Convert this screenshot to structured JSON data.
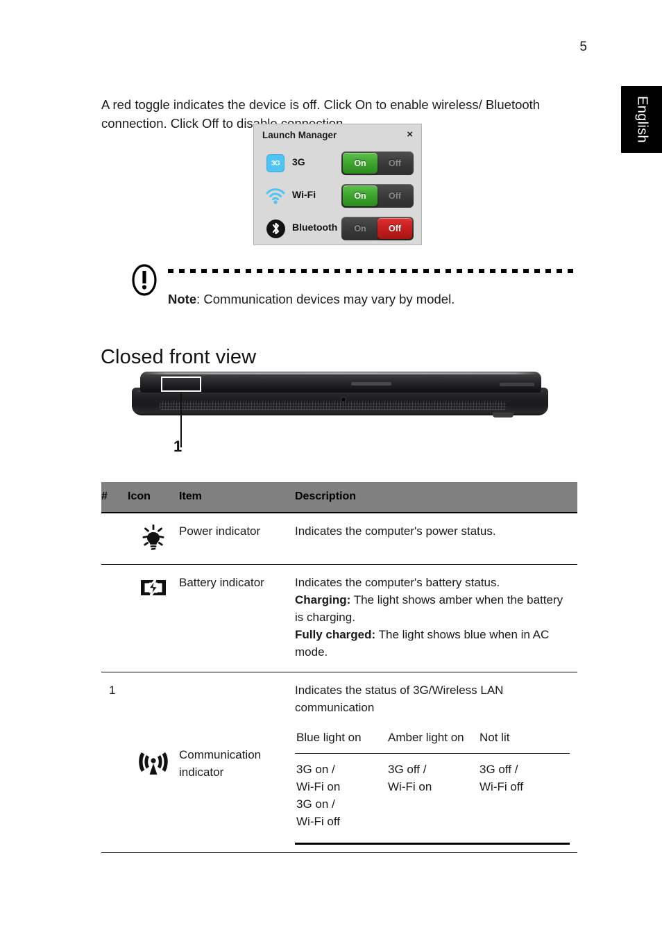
{
  "page": {
    "number": "5",
    "language_tab": "English"
  },
  "intro": {
    "paragraph": "A red toggle indicates the device is off. Click On to enable wireless/ Bluetooth connection. Click Off to disable connection."
  },
  "launch_manager": {
    "title": "Launch Manager",
    "close_label": "×",
    "rows": [
      {
        "icon": "3g-icon",
        "label": "3G",
        "on_label": "On",
        "off_label": "Off",
        "state": "on"
      },
      {
        "icon": "wifi-icon",
        "label": "Wi-Fi",
        "on_label": "On",
        "off_label": "Off",
        "state": "on"
      },
      {
        "icon": "bluetooth-icon",
        "label": "Bluetooth",
        "on_label": "On",
        "off_label": "Off",
        "state": "off"
      }
    ],
    "colors": {
      "on_green": "#3ba32c",
      "off_red": "#c41d1d",
      "window_bg": "#d9d9d9",
      "toggle_bg": "#3a3a3a"
    }
  },
  "note": {
    "icon": "exclamation-oval-icon",
    "label": "Note",
    "separator": ": ",
    "text": "Communication devices may vary by model."
  },
  "section": {
    "heading": "Closed front view",
    "figure": {
      "callout_number": "1",
      "alt": "closed-laptop-front-view"
    }
  },
  "table": {
    "headers": [
      "#",
      "Icon",
      "Item",
      "Description"
    ],
    "row_number": "1",
    "rows": [
      {
        "icon": "power-indicator-icon",
        "item": "Power indicator",
        "description_lines": [
          {
            "bold": "",
            "text": "Indicates the computer's power status."
          }
        ]
      },
      {
        "icon": "battery-indicator-icon",
        "item": "Battery indicator",
        "description_lines": [
          {
            "bold": "",
            "text": "Indicates the computer's battery status."
          },
          {
            "bold": "Charging:",
            "text": " The light shows amber when the battery is charging."
          },
          {
            "bold": "Fully charged:",
            "text": " The light shows blue when in AC mode."
          }
        ]
      },
      {
        "icon": "communication-indicator-icon",
        "item": "Communication indicator",
        "description_lines": [
          {
            "bold": "",
            "text": "Indicates the status of 3G/Wireless LAN communication"
          }
        ],
        "subtable": {
          "headers": [
            "Blue light on",
            "Amber light on",
            "Not lit"
          ],
          "values": [
            "3G on / Wi-Fi on 3G on / Wi-Fi off",
            "3G off / Wi-Fi on",
            "3G off / Wi-Fi off"
          ],
          "values_detail": [
            [
              "3G on /",
              "Wi-Fi on",
              "3G on /",
              "Wi-Fi off"
            ],
            [
              "3G off /",
              "Wi-Fi on"
            ],
            [
              "3G off /",
              "Wi-Fi off"
            ]
          ]
        }
      }
    ],
    "header_bg": "#808080"
  }
}
